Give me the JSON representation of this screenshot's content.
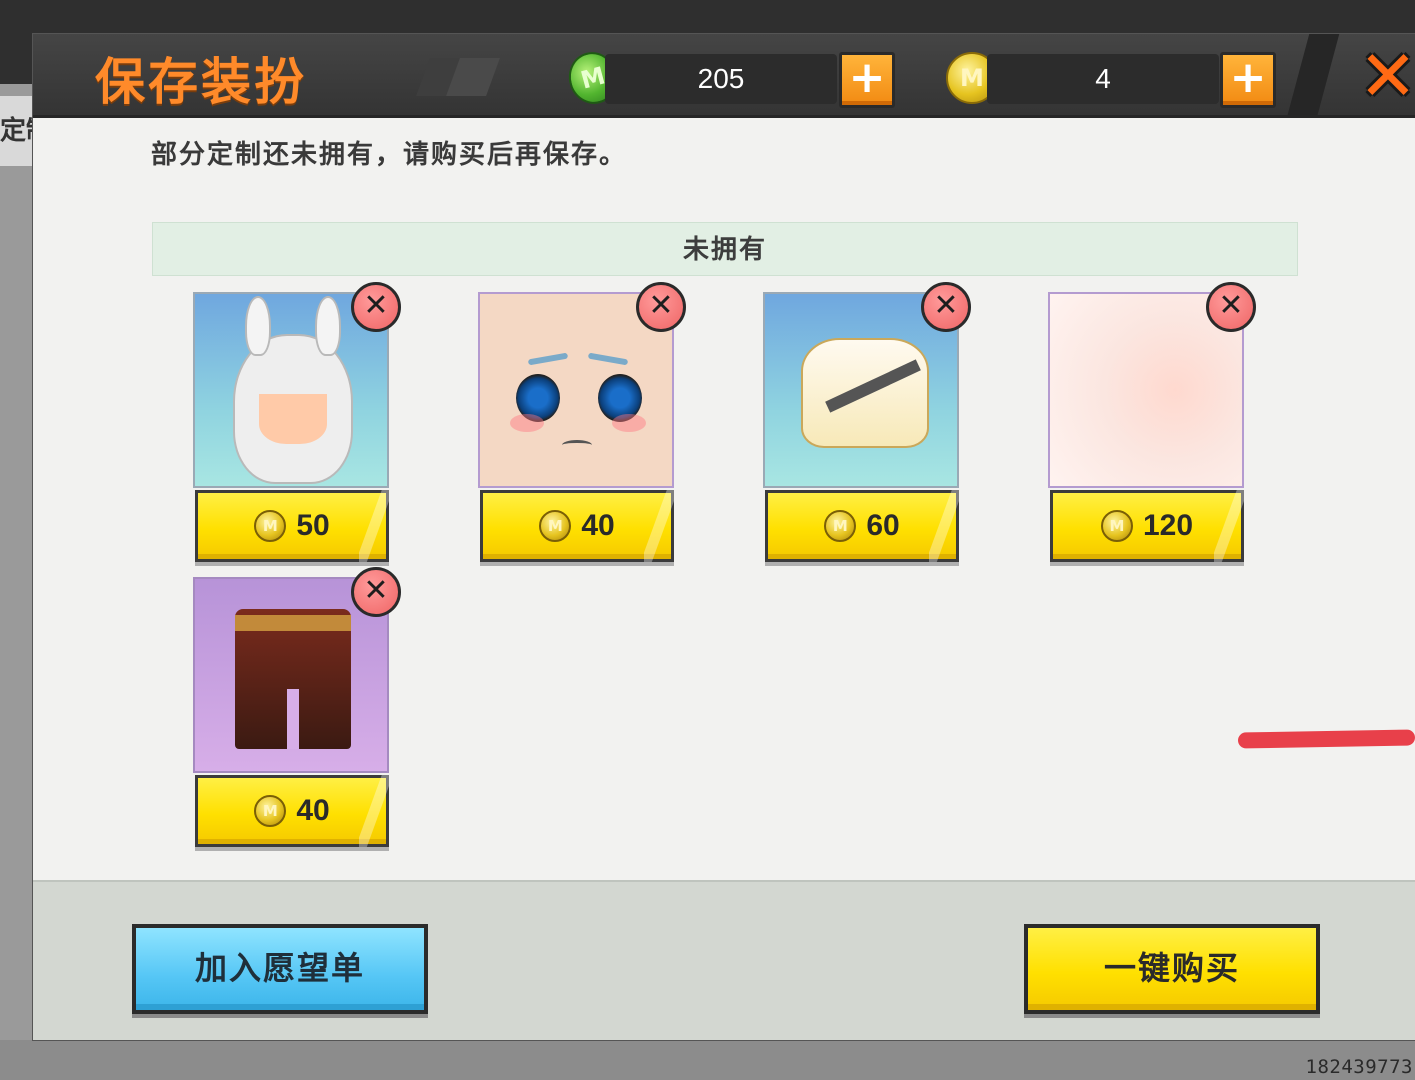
{
  "background": {
    "left_tab_text": "定制",
    "uid": "182439773"
  },
  "header": {
    "title": "保存装扮",
    "gems": "205",
    "coins": "4",
    "plus_label": "+",
    "close_label": "✕"
  },
  "notice": "部分定制还未拥有，请购买后再保存。",
  "section": {
    "title": "未拥有"
  },
  "items": [
    {
      "kind": "hairstyle",
      "price": "50"
    },
    {
      "kind": "face",
      "price": "40"
    },
    {
      "kind": "jacket",
      "price": "60"
    },
    {
      "kind": "skin-tone",
      "price": "120"
    },
    {
      "kind": "shorts",
      "price": "40"
    }
  ],
  "footer": {
    "wishlist_label": "加入愿望单",
    "buy_all_label": "一键购买"
  },
  "colors": {
    "title_orange": "#ff8a2a",
    "price_yellow": "#ffe000",
    "wishlist_blue": "#55c6f5",
    "remove_red": "#ef6565",
    "annotation_red": "#e8404a"
  },
  "icons": {
    "gem": "gem-icon",
    "coin": "coin-icon",
    "remove": "close-icon",
    "plus": "plus-icon"
  }
}
